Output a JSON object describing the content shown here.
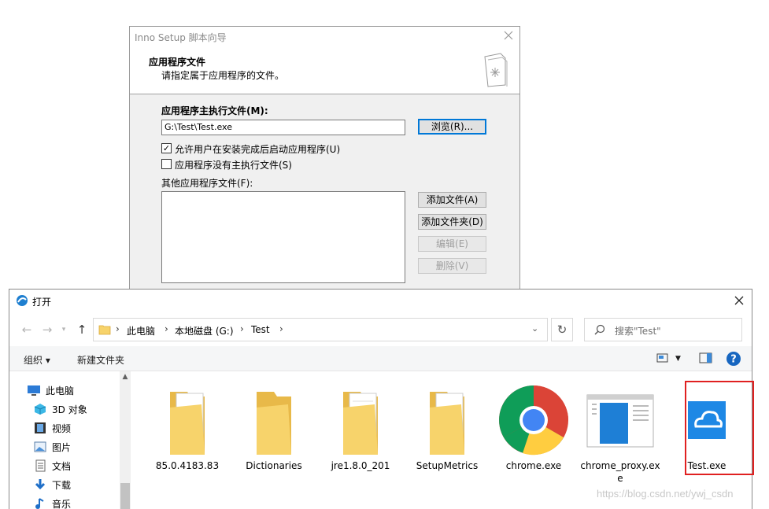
{
  "wizard": {
    "title": "Inno Setup 脚本向导",
    "header_title": "应用程序文件",
    "header_subtitle": "请指定属于应用程序的文件。",
    "main_exe_label": "应用程序主执行文件(M):",
    "main_exe_value": "G:\\Test\\Test.exe",
    "browse_button": "浏览(R)...",
    "allow_start_label": "允许用户在安装完成后启动应用程序(U)",
    "allow_start_checked": true,
    "no_main_exe_label": "应用程序没有主执行文件(S)",
    "no_main_exe_checked": false,
    "other_files_label": "其他应用程序文件(F):",
    "add_file_button": "添加文件(A)",
    "add_folder_button": "添加文件夹(D)",
    "edit_button": "编辑(E)",
    "delete_button": "删除(V)"
  },
  "open_dialog": {
    "title": "打开",
    "breadcrumb": [
      "此电脑",
      "本地磁盘 (G:)",
      "Test"
    ],
    "search_placeholder": "搜索\"Test\"",
    "organize_label": "组织 ▾",
    "new_folder_label": "新建文件夹",
    "nav_items": [
      {
        "label": "此电脑",
        "icon": "computer-icon"
      },
      {
        "label": "3D 对象",
        "icon": "cube-3d-icon"
      },
      {
        "label": "视频",
        "icon": "video-icon"
      },
      {
        "label": "图片",
        "icon": "picture-icon"
      },
      {
        "label": "文档",
        "icon": "document-icon"
      },
      {
        "label": "下载",
        "icon": "download-icon"
      },
      {
        "label": "音乐",
        "icon": "music-icon"
      }
    ],
    "files": [
      {
        "name": "85.0.4183.83",
        "type": "folder"
      },
      {
        "name": "Dictionaries",
        "type": "folder"
      },
      {
        "name": "jre1.8.0_201",
        "type": "folder"
      },
      {
        "name": "SetupMetrics",
        "type": "folder"
      },
      {
        "name": "chrome.exe",
        "type": "exe"
      },
      {
        "name": "chrome_proxy.exe",
        "type": "exe"
      },
      {
        "name": "Test.exe",
        "type": "exe",
        "selected": true
      }
    ]
  },
  "watermark": "https://blog.csdn.net/ywj_csdn",
  "colors": {
    "accent": "#0078d7",
    "highlight": "#e02020",
    "folder": "#f7d36b"
  }
}
